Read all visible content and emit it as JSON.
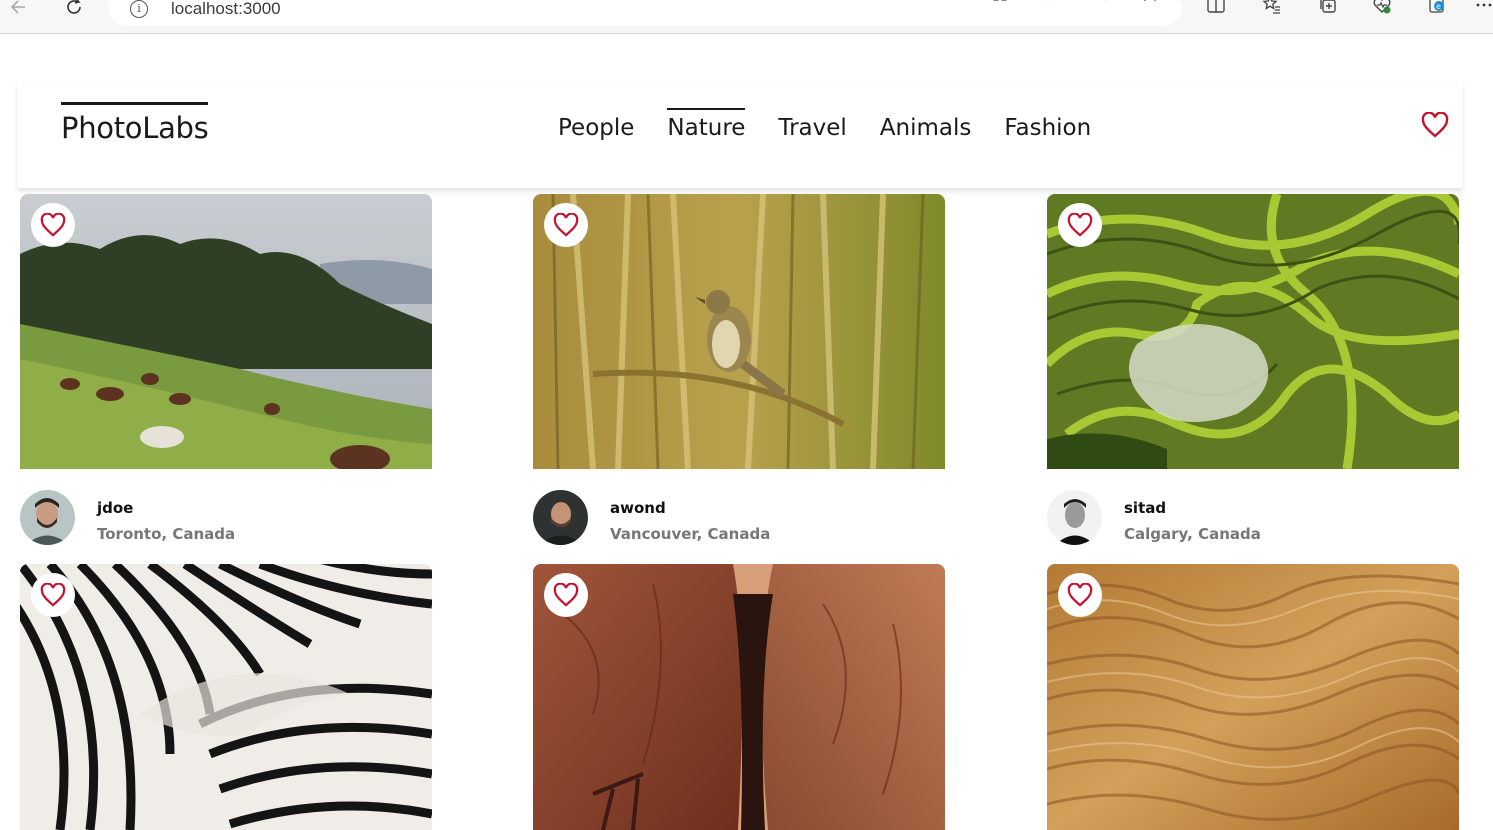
{
  "browser": {
    "url": "localhost:3000",
    "icons": [
      "back-arrow-icon",
      "refresh-icon",
      "site-info-icon",
      "app-available-icon",
      "apps-grid-icon",
      "read-aloud-icon",
      "zoom-icon",
      "favorite-star-icon",
      "split-screen-icon",
      "favorites-list-icon",
      "collections-icon",
      "browser-essentials-icon",
      "edge-copilot-icon",
      "more-icon"
    ]
  },
  "app": {
    "logo": "PhotoLabs",
    "topics": [
      {
        "label": "People",
        "active": false
      },
      {
        "label": "Nature",
        "active": true
      },
      {
        "label": "Travel",
        "active": false
      },
      {
        "label": "Animals",
        "active": false
      },
      {
        "label": "Fashion",
        "active": false
      }
    ],
    "favorites_icon": "heart-outline-icon",
    "accent_color": "#c8102e"
  },
  "photos": [
    {
      "subject": "horses-grazing-hillside",
      "user": {
        "username": "jdoe",
        "location": "Toronto, Canada"
      }
    },
    {
      "subject": "bird-in-reeds",
      "user": {
        "username": "awond",
        "location": "Vancouver, Canada"
      }
    },
    {
      "subject": "rice-terraces",
      "user": {
        "username": "sitad",
        "location": "Calgary, Canada"
      }
    },
    {
      "subject": "zebra-stripes"
    },
    {
      "subject": "canyon-rock-formation"
    },
    {
      "subject": "desert-sand-dunes"
    }
  ]
}
